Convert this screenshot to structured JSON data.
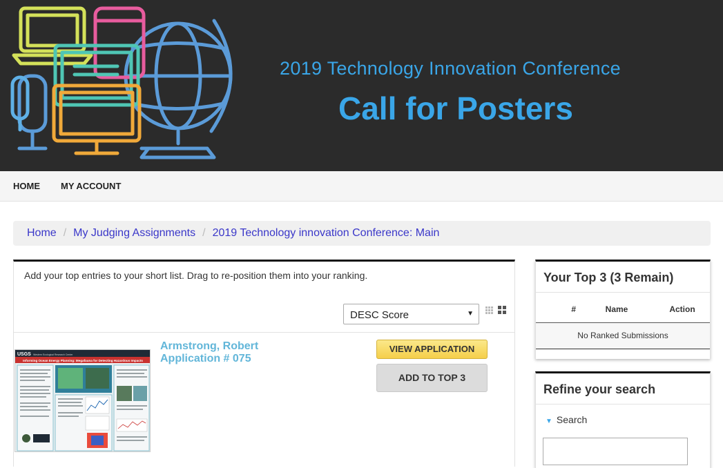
{
  "banner": {
    "subtitle": "2019 Technology Innovation Conference",
    "title": "Call for Posters"
  },
  "nav": {
    "items": [
      "HOME",
      "MY ACCOUNT"
    ]
  },
  "breadcrumb": {
    "items": [
      "Home",
      "My Judging Assignments",
      "2019 Technology innovation Conference: Main"
    ]
  },
  "main": {
    "intro": "Add your top entries to your short list. Drag to re-position them into your ranking.",
    "sort": {
      "selected": "DESC Score"
    },
    "view_toggle_icons": [
      "grid-small-icon",
      "grid-large-icon"
    ],
    "entry": {
      "name": "Armstrong, Robert",
      "application": "Application # 075",
      "view_label": "VIEW APPLICATION",
      "add_label": "ADD TO TOP 3",
      "poster": {
        "logo": "USGS",
        "header": "Western Ecological Research Center",
        "title": "Informing Ocean Energy Planning: Megafauna for Detecting Hazardous Impacts"
      }
    }
  },
  "sidebar": {
    "top3": {
      "title": "Your Top 3 (3 Remain)",
      "columns": [
        "#",
        "Name",
        "Action"
      ],
      "empty": "No Ranked Submissions"
    },
    "refine": {
      "title": "Refine your search",
      "search_label": "Search"
    }
  },
  "colors": {
    "accent": "#3aa6e8",
    "link": "#3a37c9",
    "entry_name": "#62b6d9",
    "banner_bg": "#2b2b2b"
  }
}
